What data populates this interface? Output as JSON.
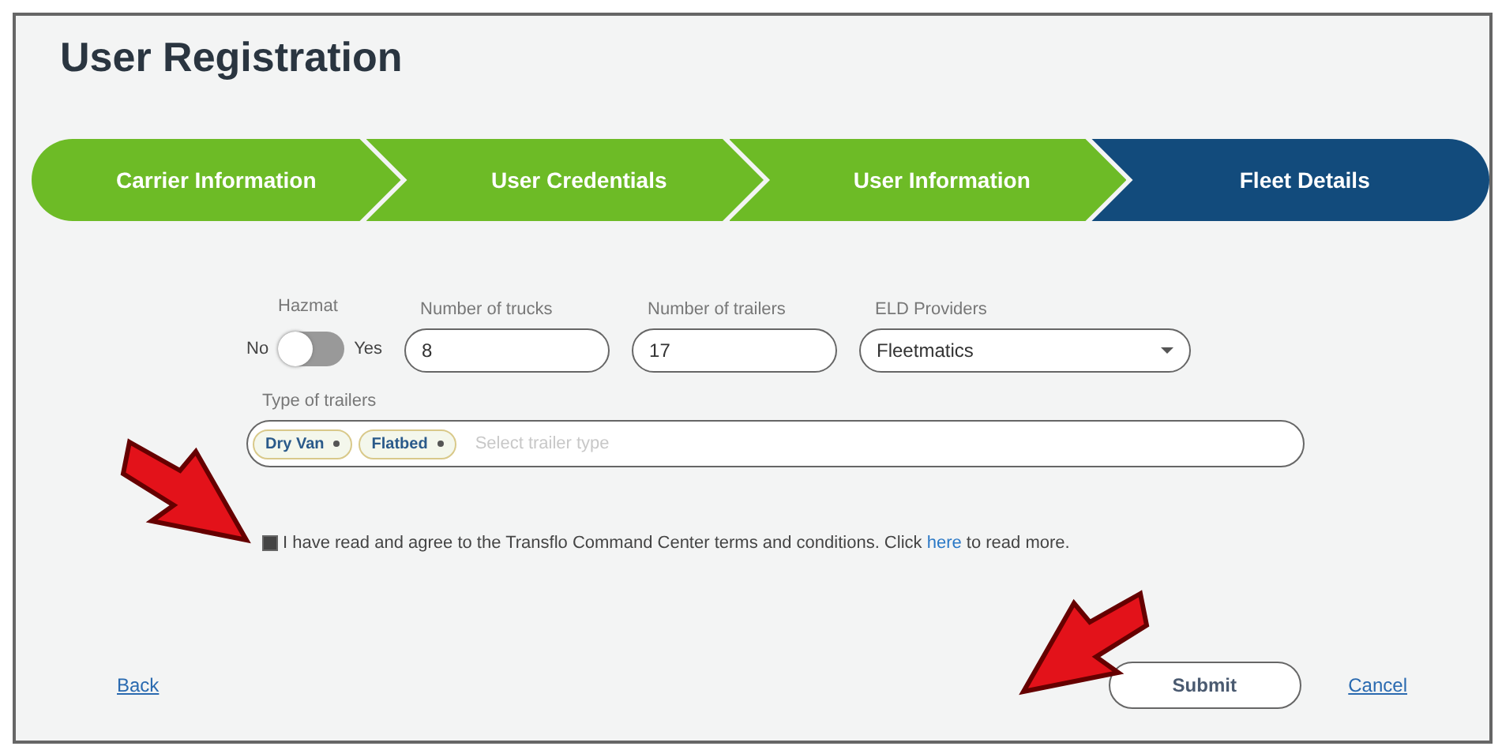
{
  "page": {
    "title": "User Registration"
  },
  "steps": [
    {
      "label": "Carrier Information",
      "selected": false
    },
    {
      "label": "User Credentials",
      "selected": false
    },
    {
      "label": "User Information",
      "selected": false
    },
    {
      "label": "Fleet Details",
      "selected": true
    }
  ],
  "hazmat": {
    "label": "Hazmat",
    "off_label": "No",
    "on_label": "Yes",
    "on": false
  },
  "fields": [
    {
      "label": "Number of trucks",
      "value": "8",
      "kind": "text"
    },
    {
      "label": "Number of trailers",
      "value": "17",
      "kind": "text"
    },
    {
      "label": "ELD Providers",
      "value": "Fleetmatics",
      "kind": "select"
    }
  ],
  "trailers": {
    "label": "Type of trailers",
    "tags": [
      "Dry Van",
      "Flatbed"
    ],
    "placeholder": "Select trailer type"
  },
  "terms": {
    "checked": true,
    "text": "I have read and agree to the Transflo Command Center terms and conditions. Click",
    "link": "here",
    "after": "to read more."
  },
  "footer": {
    "back": "Back",
    "submit": "Submit",
    "cancel": "Cancel"
  }
}
